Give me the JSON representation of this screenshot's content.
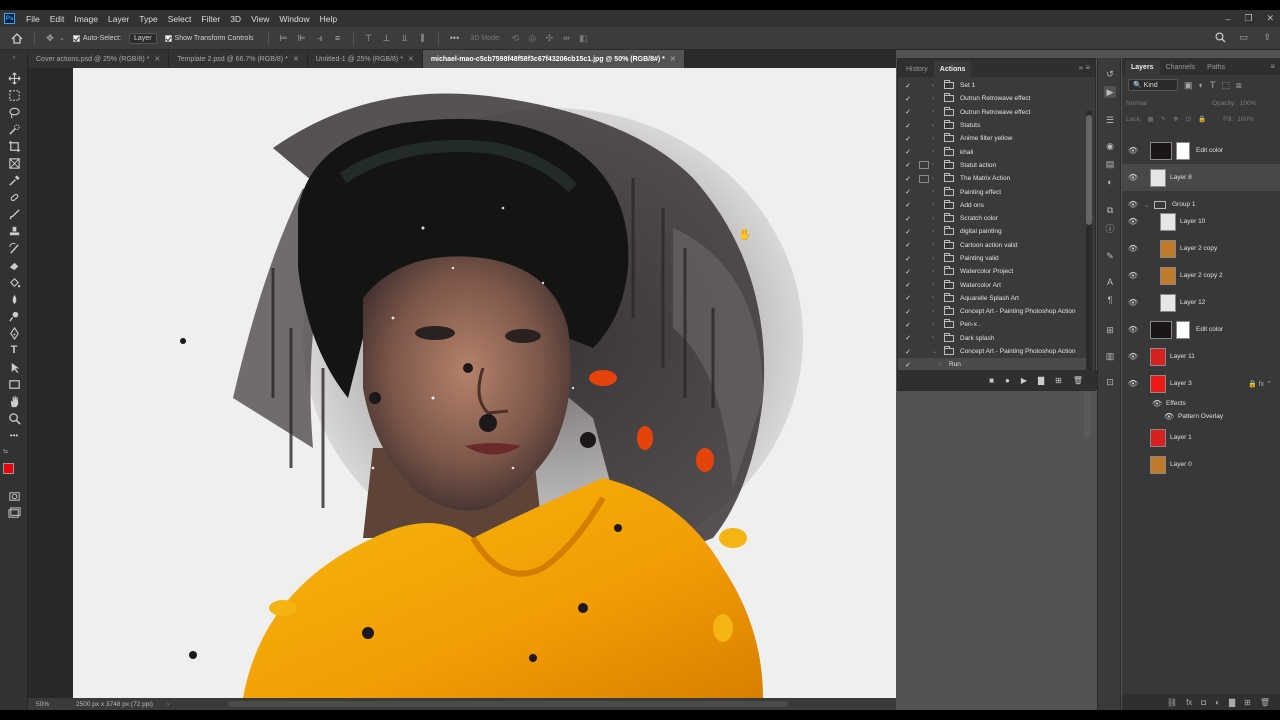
{
  "menubar": {
    "logo": "Ps",
    "items": [
      "File",
      "Edit",
      "Image",
      "Layer",
      "Type",
      "Select",
      "Filter",
      "3D",
      "View",
      "Window",
      "Help"
    ]
  },
  "options": {
    "auto_select_label": "Auto-Select:",
    "auto_select_value": "Layer",
    "transform_label": "Show Transform Controls",
    "mode_3d_label": "3D Mode:"
  },
  "tabs": [
    {
      "label": "Cover actions.psd @ 25% (RGB/8) *",
      "active": false
    },
    {
      "label": "Template 2.psd @ 66.7% (RGB/8) *",
      "active": false
    },
    {
      "label": "Untitled-1 @ 25% (RGB/8) *",
      "active": false
    },
    {
      "label": "michael-mao-c5cb7598f48f58f3c67f43206cb15c1.jpg @ 50% (RGB/8#) *",
      "active": true
    }
  ],
  "status": {
    "zoom": "50%",
    "doc_info": "2500 px x 3748 px (72 ppi)"
  },
  "actions_panel": {
    "tabs": [
      "History",
      "Actions"
    ],
    "active_tab": "Actions",
    "rows": [
      {
        "label": "Set 1",
        "dialog": false,
        "expanded": false
      },
      {
        "label": "Outrun Retrowave effect",
        "dialog": false,
        "expanded": false
      },
      {
        "label": "Outrun Retrowave effect",
        "dialog": false,
        "expanded": false
      },
      {
        "label": "Statuts",
        "dialog": false,
        "expanded": false
      },
      {
        "label": "Anime filter yellow",
        "dialog": false,
        "expanded": false
      },
      {
        "label": "khali",
        "dialog": false,
        "expanded": false
      },
      {
        "label": "Statut action",
        "dialog": true,
        "expanded": false
      },
      {
        "label": "The Matrix Action",
        "dialog": true,
        "expanded": false
      },
      {
        "label": "Painting effect",
        "dialog": false,
        "expanded": false
      },
      {
        "label": "Add ons",
        "dialog": false,
        "expanded": false
      },
      {
        "label": "Scratch color",
        "dialog": false,
        "expanded": false
      },
      {
        "label": "digital painting",
        "dialog": false,
        "expanded": false
      },
      {
        "label": "Cartoon action valid",
        "dialog": false,
        "expanded": false
      },
      {
        "label": "Painting valid",
        "dialog": false,
        "expanded": false
      },
      {
        "label": "Watercolor Project",
        "dialog": false,
        "expanded": false
      },
      {
        "label": "Watercolor Art",
        "dialog": false,
        "expanded": false
      },
      {
        "label": "Aquarelle Splash Art",
        "dialog": false,
        "expanded": false
      },
      {
        "label": "Concept Art - Painting Photoshop Action",
        "dialog": false,
        "expanded": false
      },
      {
        "label": "Pen-x .",
        "dialog": false,
        "expanded": false
      },
      {
        "label": "Dark splash",
        "dialog": false,
        "expanded": false
      },
      {
        "label": "Concept Art - Painting Photoshop Action",
        "dialog": false,
        "expanded": true
      }
    ],
    "sub_action": "Run"
  },
  "layers_panel": {
    "tabs": [
      "Layers",
      "Channels",
      "Paths"
    ],
    "active_tab": "Layers",
    "filter_kind": "Kind",
    "blend_mode": "Normal",
    "opacity_label": "Opacity:",
    "opacity_value": "100%",
    "lock_label": "Lock:",
    "fill_label": "Fill:",
    "fill_value": "100%",
    "layers": [
      {
        "name": "Edit color",
        "type": "adjustment"
      },
      {
        "name": "Layer 8",
        "type": "normal",
        "selected": true
      },
      {
        "name": "Group 1",
        "type": "group"
      },
      {
        "name": "Layer 10",
        "type": "normal"
      },
      {
        "name": "Layer 2 copy",
        "type": "photo"
      },
      {
        "name": "Layer 2 copy 2",
        "type": "photo"
      },
      {
        "name": "Layer 12",
        "type": "normal"
      },
      {
        "name": "Edit color",
        "type": "adjustment"
      },
      {
        "name": "Layer 11",
        "type": "red"
      },
      {
        "name": "Layer 3",
        "type": "fill-red"
      },
      {
        "name": "Effects",
        "type": "effects"
      },
      {
        "name": "Pattern Overlay",
        "type": "effect-item"
      },
      {
        "name": "Layer 1",
        "type": "red"
      },
      {
        "name": "Layer 0",
        "type": "photo"
      }
    ]
  },
  "colors": {
    "foreground": "#e8000b",
    "background": "#ffffff",
    "accent": "#31a8ff"
  }
}
